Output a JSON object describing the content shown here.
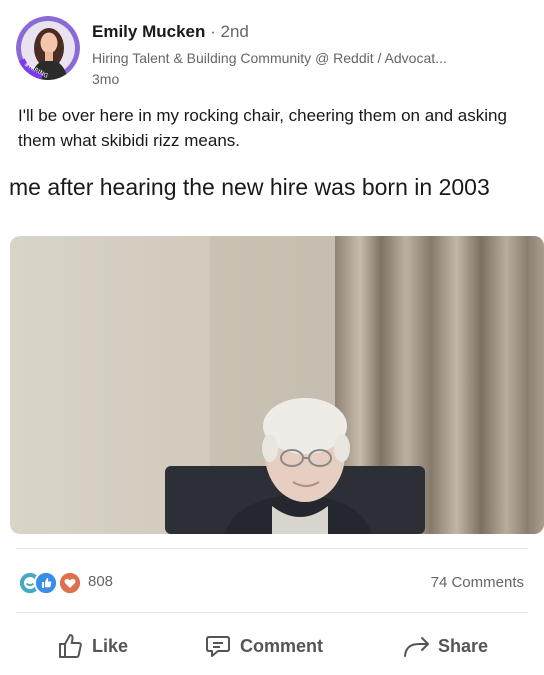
{
  "post": {
    "author_name": "Emily Mucken",
    "connection_degree": "· 2nd",
    "headline": "Hiring Talent & Building Community @ Reddit / Advocat...",
    "time_ago": "3mo",
    "avatar_badge": "#HIRING",
    "text": "I'll be over here in my rocking chair, cheering them on and asking them what skibidi rizz means.",
    "meme_caption": "me after hearing the new hire was born in 2003"
  },
  "social": {
    "reaction_icons": [
      "smile-reaction-icon",
      "like-reaction-icon",
      "love-reaction-icon"
    ],
    "reaction_count": "808",
    "comments_count": "74 Comments"
  },
  "actions": {
    "like_label": "Like",
    "comment_label": "Comment",
    "share_label": "Share"
  },
  "colors": {
    "hiring_ring": "#7c3aed",
    "reaction_blue": "#378fe9",
    "reaction_red": "#df704d",
    "reaction_teal": "#44a8c6"
  }
}
